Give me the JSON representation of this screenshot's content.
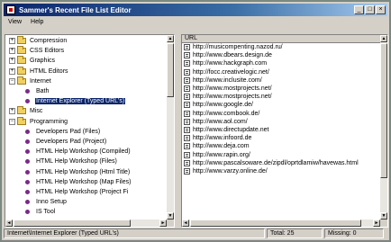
{
  "window": {
    "title": "Sammer's Recent File List Editor"
  },
  "titlebar_buttons": {
    "minimize": "_",
    "maximize": "□",
    "close": "×"
  },
  "menu": {
    "view": "View",
    "help": "Help"
  },
  "tree": {
    "items": [
      {
        "label": "Compression",
        "type": "folder",
        "expander": "+"
      },
      {
        "label": "CSS Editors",
        "type": "folder",
        "expander": "+"
      },
      {
        "label": "Graphics",
        "type": "folder",
        "expander": "+"
      },
      {
        "label": "HTML Editors",
        "type": "folder",
        "expander": "+"
      },
      {
        "label": "Internet",
        "type": "folder",
        "expander": "−"
      },
      {
        "label": "Bath",
        "type": "leaf",
        "expander": ""
      },
      {
        "label": "Internet Explorer (Typed URL's)",
        "type": "leaf",
        "expander": "",
        "selected": true
      },
      {
        "label": "Misc",
        "type": "folder",
        "expander": "+"
      },
      {
        "label": "Programming",
        "type": "folder",
        "expander": "−"
      },
      {
        "label": "Developers Pad (Files)",
        "type": "leaf",
        "expander": ""
      },
      {
        "label": "Developers Pad (Project)",
        "type": "leaf",
        "expander": ""
      },
      {
        "label": "HTML Help Workshop (Compiled)",
        "type": "leaf",
        "expander": ""
      },
      {
        "label": "HTML Help Workshop (Files)",
        "type": "leaf",
        "expander": ""
      },
      {
        "label": "HTML Help Workshop (Html Title)",
        "type": "leaf",
        "expander": ""
      },
      {
        "label": "HTML Help Workshop (Map Files)",
        "type": "leaf",
        "expander": ""
      },
      {
        "label": "HTML Help Workshop (Project Fi",
        "type": "leaf",
        "expander": ""
      },
      {
        "label": "Inno Setup",
        "type": "leaf",
        "expander": ""
      },
      {
        "label": "IS Tool",
        "type": "leaf",
        "expander": ""
      }
    ]
  },
  "url_list": {
    "header": "URL",
    "rows": [
      "http://musicompenting.nazod.ru/",
      "http://www.dbears.design.de",
      "http://www.hackgraph.com",
      "http://focc.creativelogic.net/",
      "http://www.inclusite.com/",
      "http://www.mostprojects.net/",
      "http://www.mostprojects.net/",
      "http://www.google.de/",
      "http://www.combook.de/",
      "http://www.aol.com/",
      "http://www.directupdate.net",
      "http://www.infoord.de",
      "http://www.deja.com",
      "http://www.rapin.org/",
      "http://www.pascalsoware.de/zipdl/oprtdlamiw/havewas.html",
      "http://www.varzy.online.de/"
    ]
  },
  "status": {
    "path": "Internet\\Internet Explorer (Typed URL's)",
    "total": "Total: 25",
    "missing": "Missing: 0"
  },
  "scroll_arrows": {
    "up": "▲",
    "down": "▼",
    "left": "◄",
    "right": "►"
  }
}
